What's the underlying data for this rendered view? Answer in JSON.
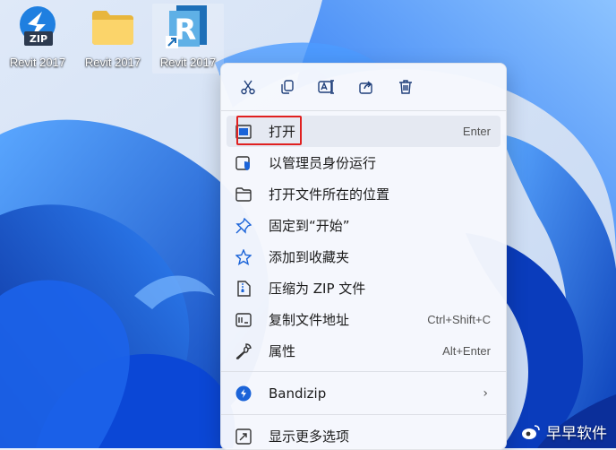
{
  "desktop": {
    "icons": [
      {
        "label": "Revit 2017",
        "icon": "zip-archive-icon"
      },
      {
        "label": "Revit 2017",
        "icon": "folder-icon"
      },
      {
        "label": "Revit 2017",
        "icon": "revit-app-icon"
      }
    ],
    "zip_badge": "ZIP",
    "revit_letter": "R"
  },
  "context_menu": {
    "toolbar": [
      {
        "name": "cut",
        "icon": "scissors-icon"
      },
      {
        "name": "copy",
        "icon": "copy-icon"
      },
      {
        "name": "rename",
        "icon": "rename-icon"
      },
      {
        "name": "share",
        "icon": "share-icon"
      },
      {
        "name": "delete",
        "icon": "trash-icon"
      }
    ],
    "items": [
      {
        "label": "打开",
        "shortcut": "Enter",
        "icon": "open-app-icon"
      },
      {
        "label": "以管理员身份运行",
        "shortcut": "",
        "icon": "admin-shield-icon"
      },
      {
        "label": "打开文件所在的位置",
        "shortcut": "",
        "icon": "folder-open-icon"
      },
      {
        "label": "固定到“开始”",
        "shortcut": "",
        "icon": "pin-icon"
      },
      {
        "label": "添加到收藏夹",
        "shortcut": "",
        "icon": "star-icon"
      },
      {
        "label": "压缩为 ZIP 文件",
        "shortcut": "",
        "icon": "zip-file-icon"
      },
      {
        "label": "复制文件地址",
        "shortcut": "Ctrl+Shift+C",
        "icon": "copy-path-icon"
      },
      {
        "label": "属性",
        "shortcut": "Alt+Enter",
        "icon": "wrench-icon"
      },
      {
        "label": "Bandizip",
        "shortcut": "",
        "icon": "bandizip-icon",
        "has_submenu": true
      },
      {
        "label": "显示更多选项",
        "shortcut": "",
        "icon": "more-options-icon"
      }
    ],
    "submenu_arrow": "›"
  },
  "watermark": {
    "text": "早早软件"
  },
  "colors": {
    "accent": "#0067c0",
    "highlight_box": "#e02020",
    "wallpaper": "#1a5fe0"
  }
}
